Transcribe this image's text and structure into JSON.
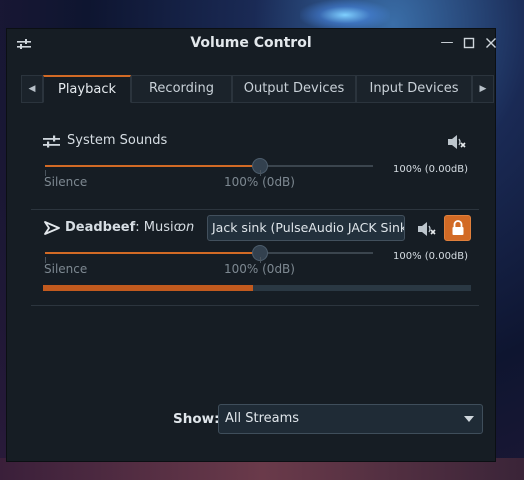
{
  "window": {
    "title": "Volume Control"
  },
  "tabs": [
    {
      "label": "Playback"
    },
    {
      "label": "Recording"
    },
    {
      "label": "Output Devices"
    },
    {
      "label": "Input Devices"
    }
  ],
  "system_sounds": {
    "name": "System Sounds",
    "slider_level_percent": 100,
    "scale_min_label": "Silence",
    "scale_mid_label": "100% (0dB)",
    "value_label": "100% (0.00dB)"
  },
  "stream": {
    "app_name": "Deadbeef",
    "separator": ": ",
    "media_name": "Music",
    "on_word": "on",
    "sink": "Jack sink (PulseAudio JACK Sink)",
    "slider_level_percent": 100,
    "scale_min_label": "Silence",
    "scale_mid_label": "100% (0dB)",
    "value_label": "100% (0.00dB)",
    "peak_meter_fraction": 0.49
  },
  "footer": {
    "show_label": "Show:",
    "show_value": "All Streams"
  },
  "colors": {
    "accent": "#d26a25",
    "window_bg": "#161d24"
  },
  "icons": [
    "window-menu-icon",
    "minimize-icon",
    "maximize-icon",
    "close-icon",
    "chevron-left-icon",
    "chevron-right-icon",
    "system-sounds-icon",
    "speaker-mute-icon",
    "deadbeef-app-icon",
    "lock-icon",
    "dropdown-arrow-icon"
  ]
}
